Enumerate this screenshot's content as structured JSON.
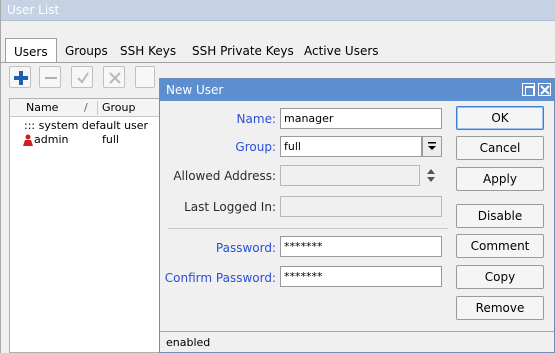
{
  "outer_window": {
    "title": "User List"
  },
  "tabs": [
    {
      "label": "Users",
      "active": true
    },
    {
      "label": "Groups",
      "active": false
    },
    {
      "label": "SSH Keys",
      "active": false
    },
    {
      "label": "SSH Private Keys",
      "active": false
    },
    {
      "label": "Active Users",
      "active": false
    }
  ],
  "toolbar": {
    "icons": [
      "add-icon",
      "remove-icon",
      "enable-icon",
      "disable-icon"
    ]
  },
  "list": {
    "columns": [
      "Name",
      "Group"
    ],
    "sort_marker": "/",
    "rows": [
      {
        "comment": "::: system default user"
      },
      {
        "name": "admin",
        "group": "full"
      }
    ]
  },
  "dialog": {
    "title": "New User",
    "name_label": "Name:",
    "name_value": "manager",
    "group_label": "Group:",
    "group_value": "full",
    "allowed_address_label": "Allowed Address:",
    "allowed_address_value": "",
    "last_logged_in_label": "Last Logged In:",
    "last_logged_in_value": "",
    "password_label": "Password:",
    "password_value": "*******",
    "confirm_password_label": "Confirm Password:",
    "confirm_password_value": "*******",
    "buttons": {
      "ok": "OK",
      "cancel": "Cancel",
      "apply": "Apply",
      "disable": "Disable",
      "comment": "Comment",
      "copy": "Copy",
      "remove": "Remove"
    },
    "status": "enabled"
  },
  "colors": {
    "dialog_title_bar": "#5c8ed0",
    "outer_title_bar": "#c5d2e3",
    "blue_label": "#2a4fd6",
    "admin_icon": "#cc2020",
    "add_icon": "#1b5fb8"
  }
}
